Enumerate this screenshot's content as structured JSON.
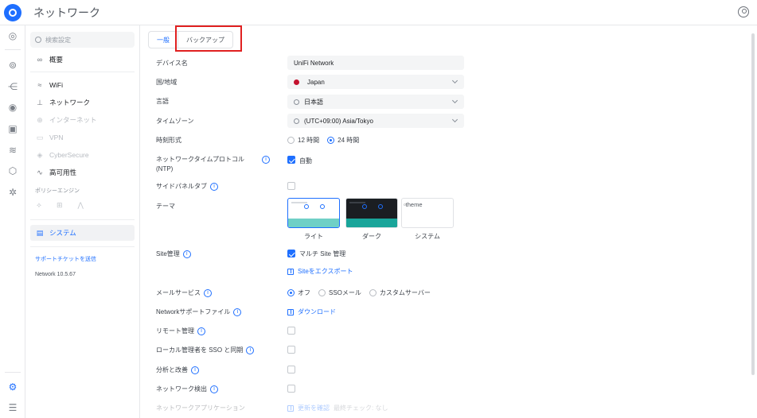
{
  "app": {
    "title": "ネットワーク"
  },
  "sidebar": {
    "search_placeholder": "検索設定",
    "items": [
      {
        "label": "概要",
        "icon": "binoculars-icon"
      },
      {
        "label": "WiFi",
        "icon": "wifi-icon"
      },
      {
        "label": "ネットワーク",
        "icon": "network-icon"
      },
      {
        "label": "インターネット",
        "icon": "globe-icon"
      },
      {
        "label": "VPN",
        "icon": "vpn-icon"
      },
      {
        "label": "CyberSecure",
        "icon": "shield-icon"
      },
      {
        "label": "高可用性",
        "icon": "pulse-icon"
      },
      {
        "label": "システム",
        "icon": "system-icon"
      }
    ],
    "policy_label": "ポリシーエンジン",
    "support_link": "サポートチケットを送信",
    "version": "Network 10.5.67"
  },
  "tabs": [
    {
      "label": "一般"
    },
    {
      "label": "バックアップ"
    }
  ],
  "settings": {
    "device_name": {
      "label": "デバイス名",
      "value": "UniFi Network"
    },
    "country": {
      "label": "国/地域",
      "value": "Japan"
    },
    "language": {
      "label": "言語",
      "value": "日本語"
    },
    "timezone": {
      "label": "タイムゾーン",
      "value": "(UTC+09:00) Asia/Tokyo"
    },
    "time_format": {
      "label": "時刻形式",
      "options": [
        "12 時間",
        "24 時間"
      ],
      "selected": "24 時間"
    },
    "ntp": {
      "label_line1": "ネットワークタイムプロトコル",
      "label_line2": "(NTP)",
      "check_label": "自動",
      "checked": true
    },
    "side_panel_tab": {
      "label": "サイドパネルタブ",
      "checked": false
    },
    "theme": {
      "label": "テーマ",
      "options": [
        "ライト",
        "ダーク",
        "システム"
      ],
      "selected": "ライト",
      "system_alt": "theme"
    },
    "site_management": {
      "label": "Site管理",
      "check_label": "マルチ Site 管理",
      "checked": true,
      "export_link": "Siteをエクスポート"
    },
    "mail_service": {
      "label": "メールサービス",
      "options": [
        "オフ",
        "SSOメール",
        "カスタムサーバー"
      ],
      "selected": "オフ"
    },
    "support_file": {
      "label": "Networkサポートファイル",
      "link": "ダウンロード"
    },
    "remote_management": {
      "label": "リモート管理",
      "checked": false
    },
    "local_admin_sso": {
      "label": "ローカル管理者を SSO と同期",
      "checked": false
    },
    "analytics": {
      "label": "分析と改善",
      "checked": false
    },
    "network_discovery": {
      "label": "ネットワーク検出",
      "checked": false
    },
    "network_app": {
      "label": "ネットワークアプリケーション",
      "update_link": "更新を確認",
      "last_check": "最終チェック: なし"
    }
  },
  "colors": {
    "accent": "#1e6fff",
    "highlight": "#e02020"
  }
}
